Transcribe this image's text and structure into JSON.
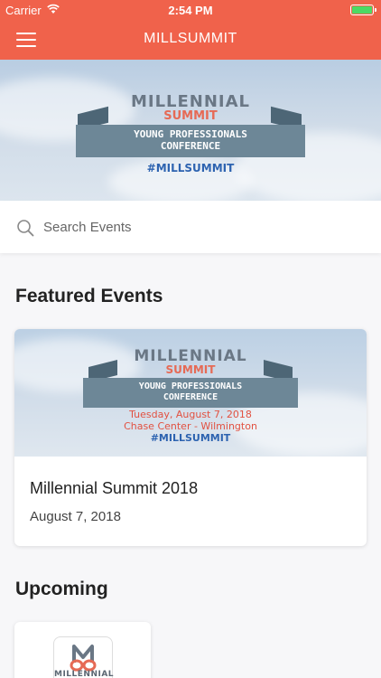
{
  "status_bar": {
    "carrier": "Carrier",
    "time": "2:54 PM"
  },
  "nav": {
    "title": "MILLSUMMIT",
    "menu_icon": "hamburger-menu-icon"
  },
  "hero": {
    "logo_line1": "MILLENNIAL",
    "logo_line2": "SUMMIT",
    "ribbon_line1": "YOUNG PROFESSIONALS",
    "ribbon_line2": "CONFERENCE",
    "hashtag": "#MILLSUMMIT"
  },
  "search": {
    "placeholder": "Search Events",
    "icon": "search-icon"
  },
  "featured": {
    "heading": "Featured Events",
    "card": {
      "banner": {
        "logo_line1": "MILLENNIAL",
        "logo_line2": "SUMMIT",
        "ribbon_line1": "YOUNG PROFESSIONALS",
        "ribbon_line2": "CONFERENCE",
        "date_line": "Tuesday, August 7, 2018",
        "venue_line": "Chase Center - Wilmington",
        "hashtag": "#MILLSUMMIT"
      },
      "title": "Millennial Summit 2018",
      "date": "August 7, 2018"
    }
  },
  "upcoming": {
    "heading": "Upcoming",
    "tile": {
      "logo_text": "MILLENNIAL"
    }
  },
  "colors": {
    "accent": "#f0624b",
    "ribbon": "#6d8797",
    "hashtag": "#2d63b0",
    "summit": "#e66a55"
  }
}
